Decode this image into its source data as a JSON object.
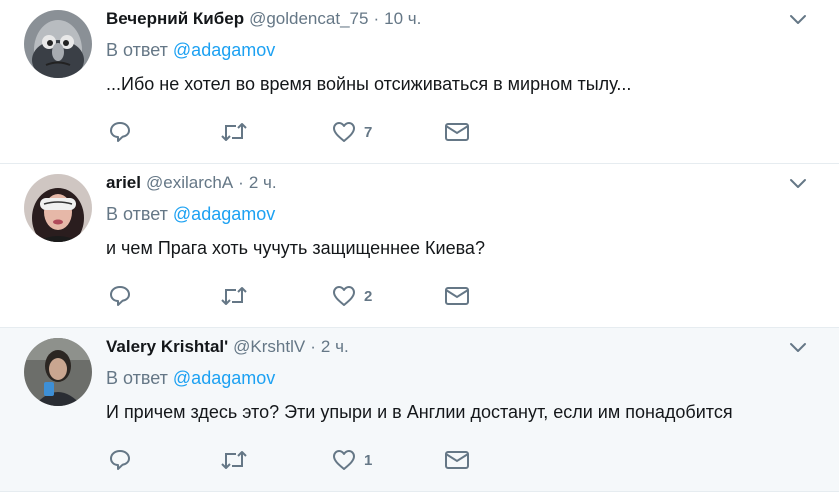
{
  "reply_prefix": "В ответ",
  "reply_target": "@adagamov",
  "dot": "·",
  "tweets": [
    {
      "name": "Вечерний Кибер",
      "handle": "@goldencat_75",
      "time": "10 ч.",
      "text": "...Ибо не хотел во время войны отсиживаться в мирном тылу...",
      "like_count": "7",
      "highlight": false
    },
    {
      "name": "ariel",
      "handle": "@exilarchA",
      "time": "2 ч.",
      "text": "и чем Прага хоть чучуть защищеннее Киева?",
      "like_count": "2",
      "highlight": false
    },
    {
      "name": "Valery Krishtal'",
      "handle": "@KrshtlV",
      "time": "2 ч.",
      "text": "И причем здесь это? Эти упыри и в Англии достанут, если им понадобится",
      "like_count": "1",
      "highlight": true
    }
  ],
  "icons": {
    "reply": "speech-bubble-icon",
    "retweet": "retweet-arrows-icon",
    "like": "heart-icon",
    "dm": "envelope-icon",
    "more": "chevron-down-icon"
  },
  "colors": {
    "link": "#1da1f2",
    "secondary": "#657786",
    "icon": "#657786",
    "border": "#e6ecf0",
    "highlight_bg": "#f5f8fa"
  }
}
